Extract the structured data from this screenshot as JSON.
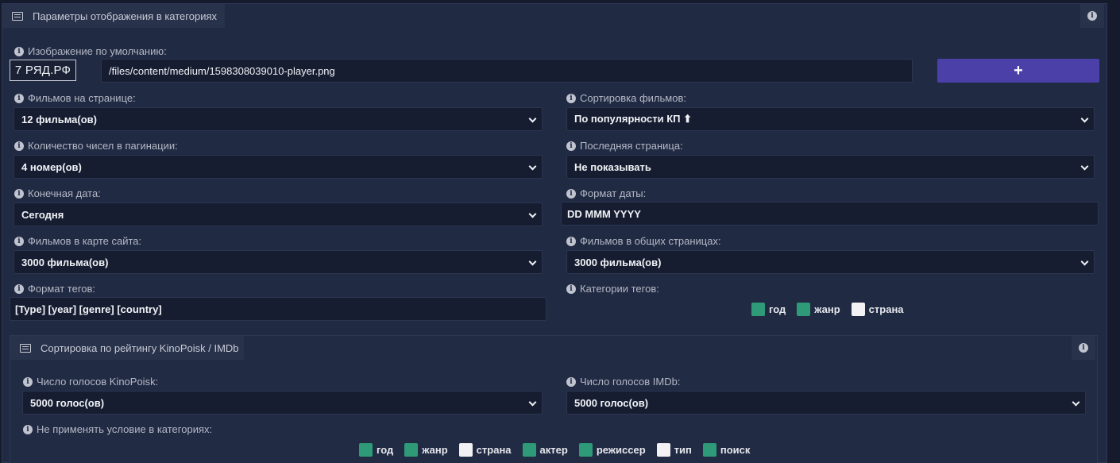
{
  "section": {
    "title": "Параметры отображения в категориях",
    "default_image_label": "Изображение по умолчанию:",
    "logo_text": "7 РЯД.РФ",
    "default_image_path": "/files/content/medium/1598308039010-player.png",
    "add_label": "+",
    "films_per_page_label": "Фильмов на странице:",
    "films_per_page_value": "12 фильма(ов)",
    "sort_label": "Сортировка фильмов:",
    "sort_value": "По популярности КП ⬆",
    "pagination_label": "Количество чисел в пагинации:",
    "pagination_value": "4 номер(ов)",
    "last_page_label": "Последняя страница:",
    "last_page_value": "Не показывать",
    "end_date_label": "Конечная дата:",
    "end_date_value": "Сегодня",
    "date_format_label": "Формат даты:",
    "date_format_value": "DD MMM YYYY",
    "sitemap_label": "Фильмов в карте сайта:",
    "sitemap_value": "3000 фильма(ов)",
    "common_pages_label": "Фильмов в общих страницах:",
    "common_pages_value": "3000 фильма(ов)",
    "tag_format_label": "Формат тегов:",
    "tag_format_value": "[Type] [year] [genre] [country]",
    "tag_categories_label": "Категории тегов:",
    "tag_categories": [
      {
        "label": "год",
        "checked": true
      },
      {
        "label": "жанр",
        "checked": true
      },
      {
        "label": "страна",
        "checked": false
      }
    ]
  },
  "rating": {
    "title": "Сортировка по рейтингу KinoPoisk / IMDb",
    "kp_votes_label": "Число голосов KinoPoisk:",
    "kp_votes_value": "5000 голос(ов)",
    "imdb_votes_label": "Число голосов IMDb:",
    "imdb_votes_value": "5000 голос(ов)",
    "exclude_label": "Не применять условие в категориях:",
    "exclude_categories": [
      {
        "label": "год",
        "checked": true
      },
      {
        "label": "жанр",
        "checked": true
      },
      {
        "label": "страна",
        "checked": false
      },
      {
        "label": "актер",
        "checked": true
      },
      {
        "label": "режиссер",
        "checked": true
      },
      {
        "label": "тип",
        "checked": false
      },
      {
        "label": "поиск",
        "checked": true
      }
    ]
  },
  "colors": {
    "accent": "#4b40a8",
    "checked": "#2e9a78",
    "background": "#212a43"
  },
  "icons": {
    "info": "info-circle-icon",
    "section": "list-card-icon"
  }
}
